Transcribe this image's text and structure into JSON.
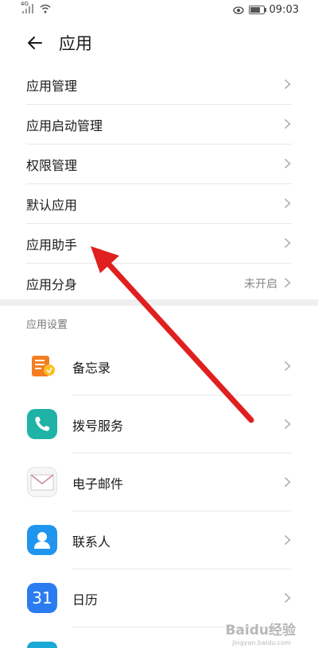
{
  "status_bar": {
    "time": "09:03",
    "network": "4G"
  },
  "header": {
    "title": "应用"
  },
  "menu": [
    {
      "label": "应用管理",
      "value": ""
    },
    {
      "label": "应用启动管理",
      "value": ""
    },
    {
      "label": "权限管理",
      "value": ""
    },
    {
      "label": "默认应用",
      "value": ""
    },
    {
      "label": "应用助手",
      "value": ""
    },
    {
      "label": "应用分身",
      "value": "未开启"
    }
  ],
  "section": {
    "title": "应用设置"
  },
  "apps": [
    {
      "label": "备忘录",
      "icon": "memo-icon"
    },
    {
      "label": "拨号服务",
      "icon": "phone-icon"
    },
    {
      "label": "电子邮件",
      "icon": "mail-icon"
    },
    {
      "label": "联系人",
      "icon": "contacts-icon"
    },
    {
      "label": "日历",
      "icon": "calendar-icon",
      "icon_text": "31"
    }
  ],
  "annotation": {
    "arrow_color": "#e01f1f"
  },
  "watermark": {
    "text": "Baidu经验",
    "sub": "jingyan.baidu.com"
  }
}
